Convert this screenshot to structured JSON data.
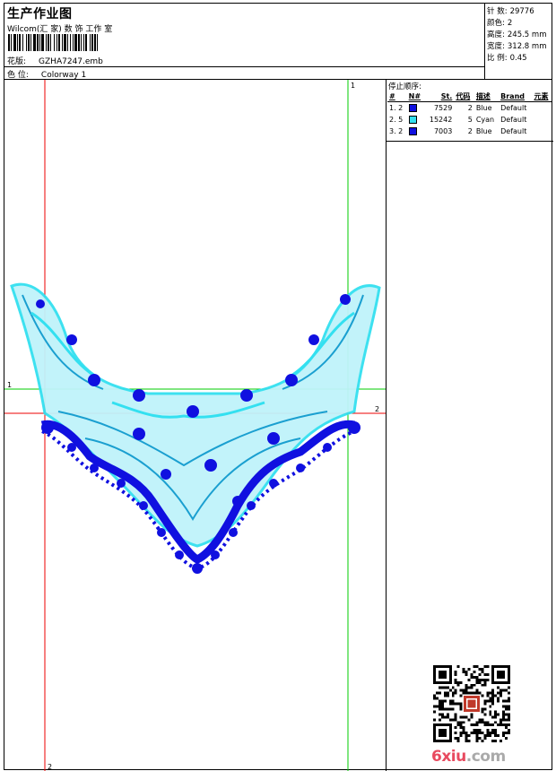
{
  "header": {
    "title": "生产作业图",
    "software": "Wilcom(汇 家) 数 饰 工作 室",
    "design_label": "花版:",
    "design_file": "GZHA7247.emb",
    "colorway_label": "色 位:",
    "colorway": "Colorway 1"
  },
  "stats": [
    {
      "label": "针 数:",
      "value": "29776"
    },
    {
      "label": "颜色:",
      "value": "2"
    },
    {
      "label": "高度:",
      "value": "245.5 mm"
    },
    {
      "label": "宽度:",
      "value": "312.8 mm"
    },
    {
      "label": "比 例:",
      "value": "0.45"
    }
  ],
  "stop_sequence": {
    "title": "停止顺序:",
    "columns": [
      "#",
      "N#",
      "St.",
      "代码",
      "描述",
      "Brand",
      "元素"
    ],
    "rows": [
      {
        "index": "1. 2",
        "color": "#1010e0",
        "stitches": "7529",
        "code": "2",
        "description": "Blue",
        "brand": "Default"
      },
      {
        "index": "2. 5",
        "color": "#33e0f0",
        "stitches": "15242",
        "code": "5",
        "description": "Cyan",
        "brand": "Default"
      },
      {
        "index": "3. 2",
        "color": "#1010e0",
        "stitches": "7003",
        "code": "2",
        "description": "Blue",
        "brand": "Default"
      }
    ]
  },
  "guides": {
    "labels": [
      "1",
      "2",
      "1",
      "2"
    ],
    "green": "#00cc00",
    "red": "#ee0000"
  },
  "colors": {
    "blue": "#1010e0",
    "cyan": "#33e0f0",
    "teal": "#1a9fd0"
  },
  "watermark": {
    "main": "6xiu",
    "suffix": ".com"
  },
  "icons": {
    "qr": "qr-code-icon",
    "barcode": "barcode-icon"
  }
}
